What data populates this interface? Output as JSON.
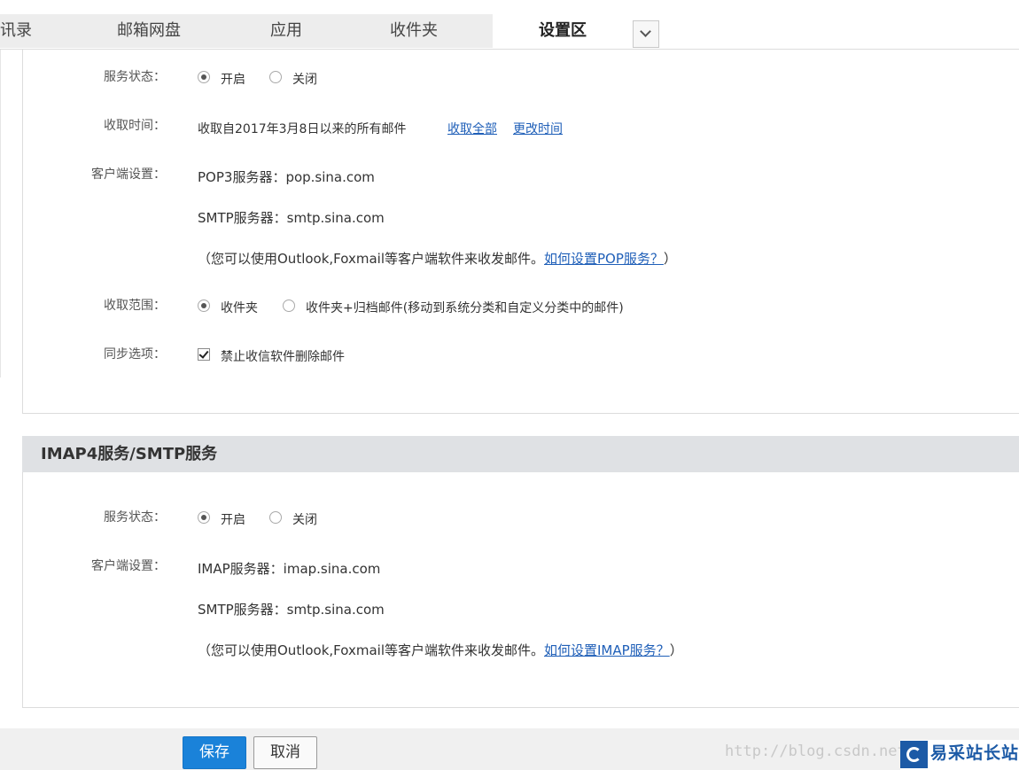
{
  "tabs": [
    {
      "label": "讯录"
    },
    {
      "label": "邮箱网盘"
    },
    {
      "label": "应用"
    },
    {
      "label": "收件夹"
    },
    {
      "label": "设置区",
      "active": true
    }
  ],
  "pop": {
    "status_label": "服务状态：",
    "status_on": "开启",
    "status_off": "关闭",
    "status_selected": "开启",
    "fetch_time_label": "收取时间：",
    "fetch_time_text": "收取自2017年3月8日以来的所有邮件",
    "fetch_all_link": "收取全部",
    "change_time_link": "更改时间",
    "client_label": "客户端设置：",
    "pop3_server": "POP3服务器：pop.sina.com",
    "smtp_server": "SMTP服务器：smtp.sina.com",
    "hint_prefix": "（您可以使用Outlook,Foxmail等客户端软件来收发邮件。",
    "hint_link": "如何设置POP服务？",
    "hint_suffix": "）",
    "scope_label": "收取范围：",
    "scope_opt1": "收件夹",
    "scope_opt2": "收件夹+归档邮件(移动到系统分类和自定义分类中的邮件)",
    "scope_selected": "收件夹",
    "sync_label": "同步选项：",
    "sync_opt": "禁止收信软件删除邮件",
    "sync_checked": true
  },
  "imap": {
    "title": "IMAP4服务/SMTP服务",
    "status_label": "服务状态：",
    "status_on": "开启",
    "status_off": "关闭",
    "status_selected": "开启",
    "client_label": "客户端设置：",
    "imap_server": "IMAP服务器：imap.sina.com",
    "smtp_server": "SMTP服务器：smtp.sina.com",
    "hint_prefix": "（您可以使用Outlook,Foxmail等客户端软件来收发邮件。",
    "hint_link": "如何设置IMAP服务？",
    "hint_suffix": "）"
  },
  "footer": {
    "save_label": "保存",
    "cancel_label": "取消",
    "watermark": "http://blog.csdn.net",
    "logo_text": "易采站长站"
  },
  "colors": {
    "primary_button": "#1a82d9",
    "link": "#1f5fb8",
    "section_header_bg": "#dfe1e4",
    "tab_bg": "#ededed"
  },
  "icons": {
    "tab_expand": "chevron-down-icon",
    "logo": "logo-icon"
  }
}
